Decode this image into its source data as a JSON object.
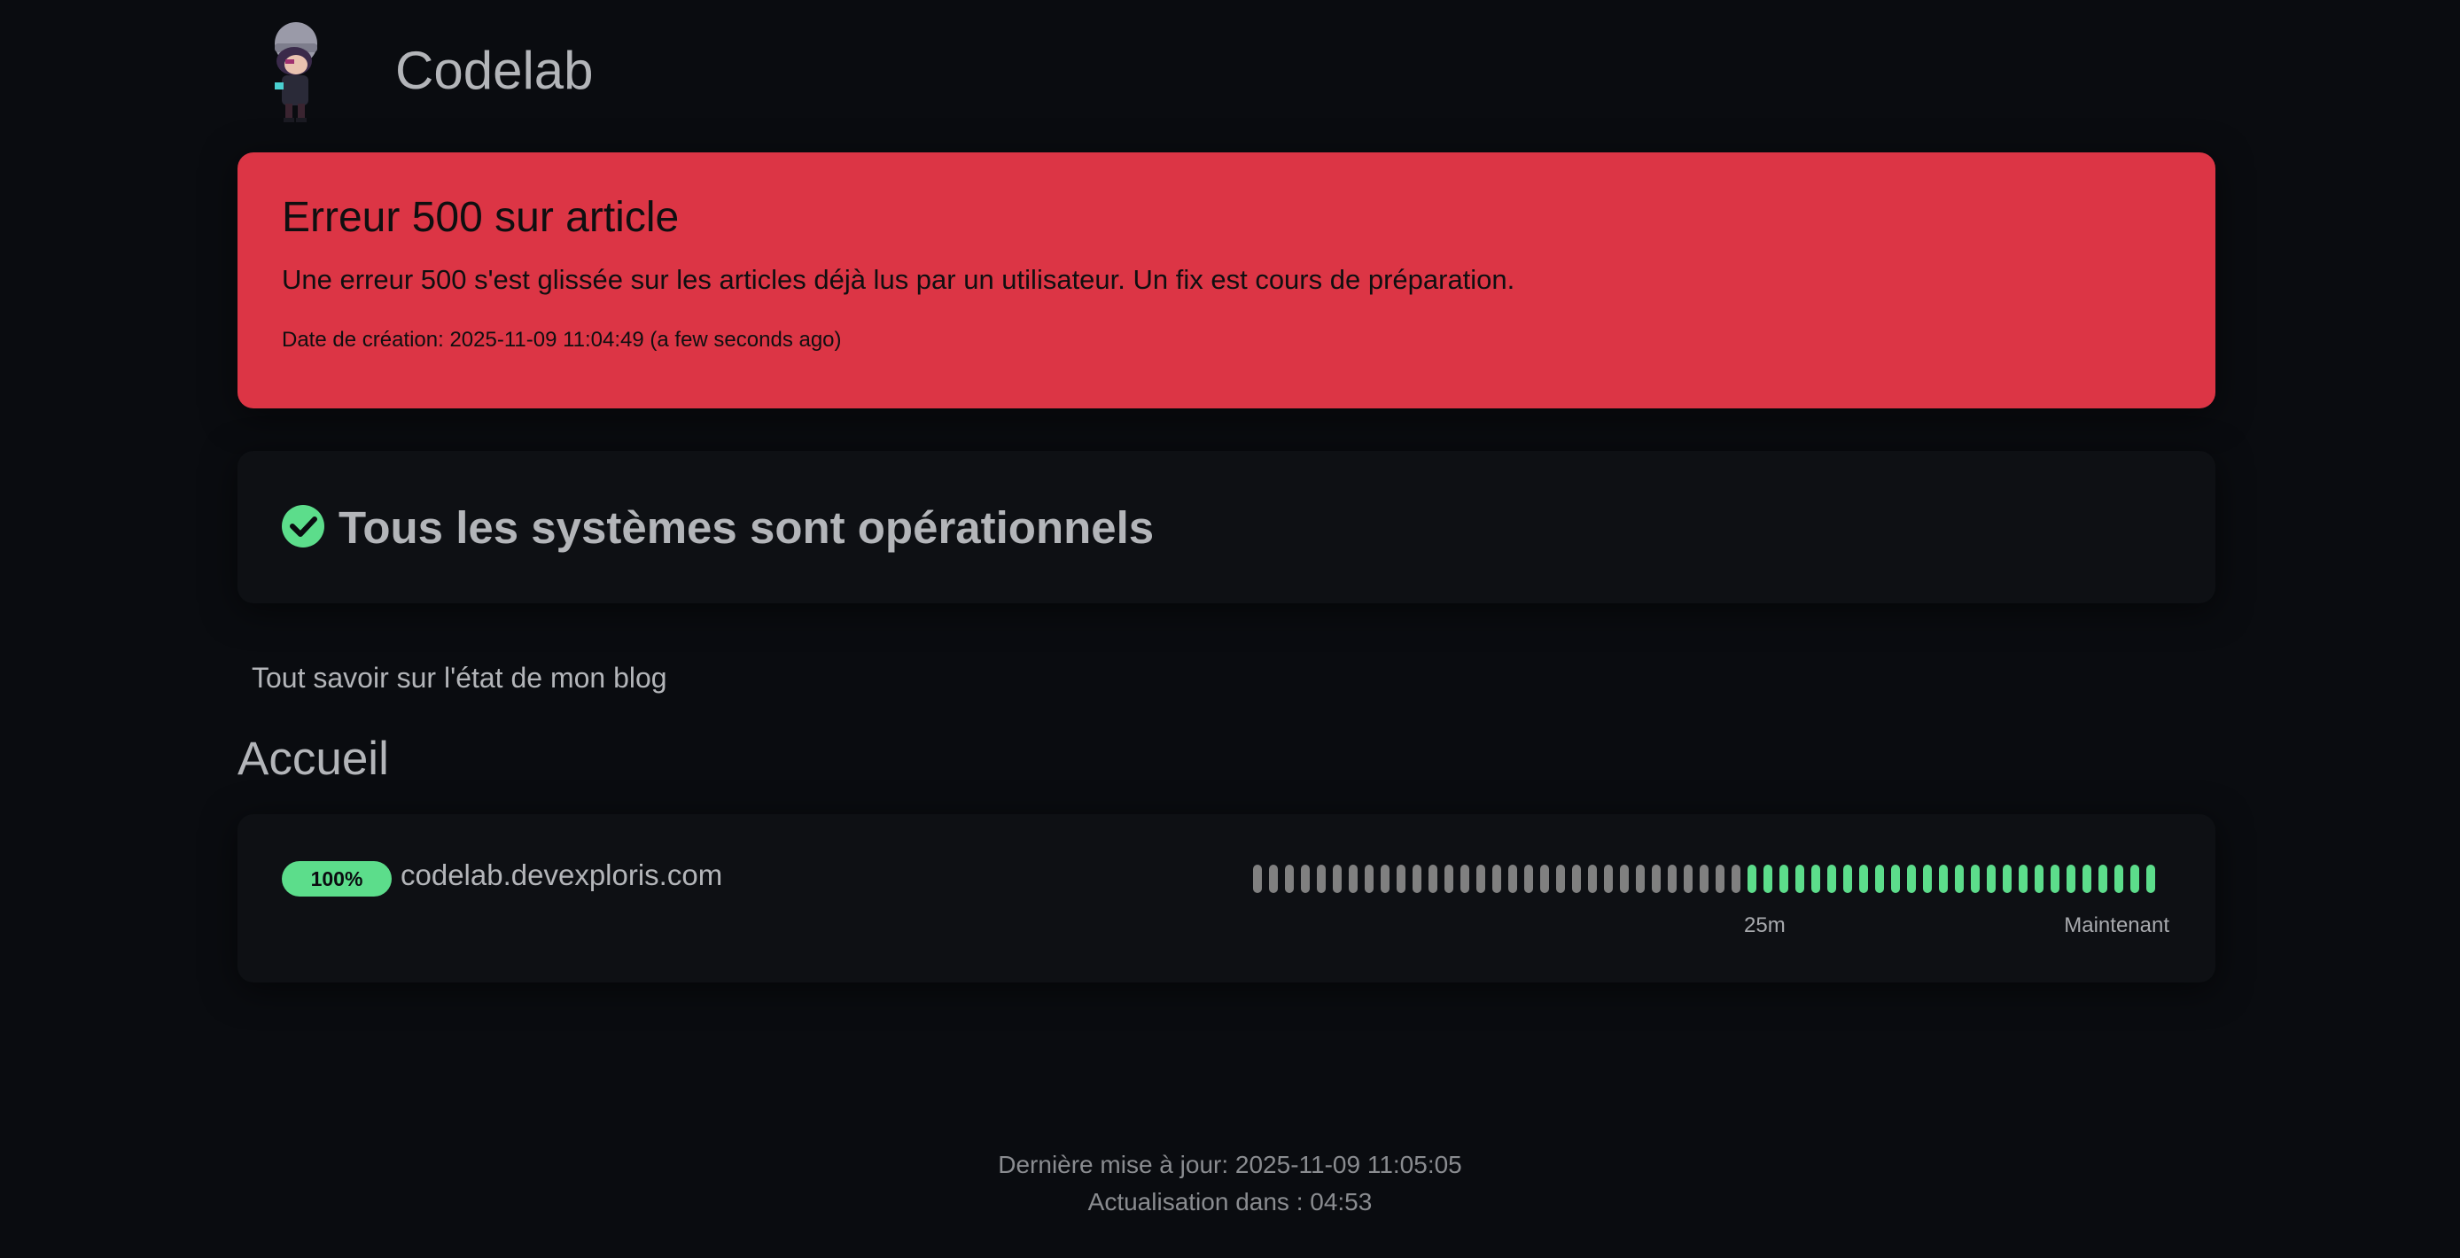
{
  "header": {
    "title": "Codelab",
    "logo": "chibi-character-avatar"
  },
  "incident": {
    "title": "Erreur 500 sur article",
    "body": "Une erreur 500 s'est glissée sur les articles déjà lus par un utilisateur. Un fix est cours de préparation.",
    "date": "Date de création: 2025-11-09 11:04:49 (a few seconds ago)",
    "color": "#dc3545"
  },
  "overall_status": {
    "icon": "check-circle-icon",
    "text": "Tous les systèmes sont opérationnels",
    "color": "#5cdd8b"
  },
  "description": "Tout savoir sur l'état de mon blog",
  "groups": [
    {
      "title": "Accueil",
      "monitors": [
        {
          "uptime": "100%",
          "name": "codelab.devexploris.com",
          "heartbeats": {
            "empty": 31,
            "up": 26
          },
          "time_start": "25m",
          "time_end": "Maintenant"
        }
      ]
    }
  ],
  "footer": {
    "last_update": "Dernière mise à jour: 2025-11-09 11:05:05",
    "refresh": "Actualisation dans : 04:53"
  },
  "colors": {
    "background": "#0a0c10",
    "card": "#0e1014",
    "up": "#5cdd8b",
    "empty": "#808080"
  }
}
